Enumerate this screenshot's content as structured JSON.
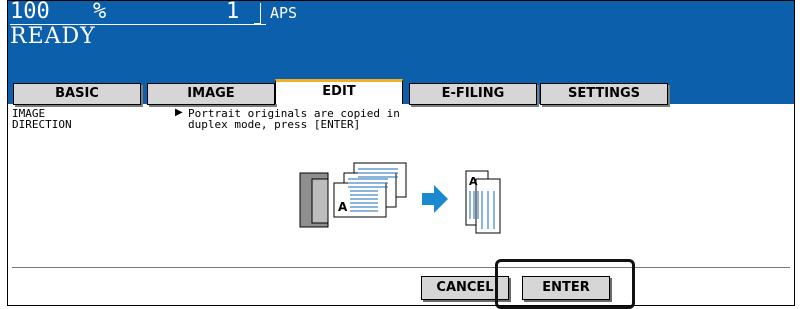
{
  "header": {
    "count": "100",
    "percent": "%",
    "copies": "1",
    "paper": "APS",
    "status": "READY",
    "background_color": "#0b5fab"
  },
  "tabs": [
    {
      "label": "BASIC",
      "active": false
    },
    {
      "label": "IMAGE",
      "active": false
    },
    {
      "label": "EDIT",
      "active": true
    },
    {
      "label": "E-FILING",
      "active": false
    },
    {
      "label": "SETTINGS",
      "active": false
    }
  ],
  "content": {
    "section_label": "IMAGE\nDIRECTION",
    "message_arrow": "▶",
    "message": "Portrait originals are copied in\nduplex mode, press [ENTER]"
  },
  "buttons": {
    "cancel_label": "CANCEL",
    "enter_label": "ENTER"
  },
  "accent_colors": {
    "active_tab_top": "#f0b020",
    "arrow": "#1a8ad0"
  }
}
